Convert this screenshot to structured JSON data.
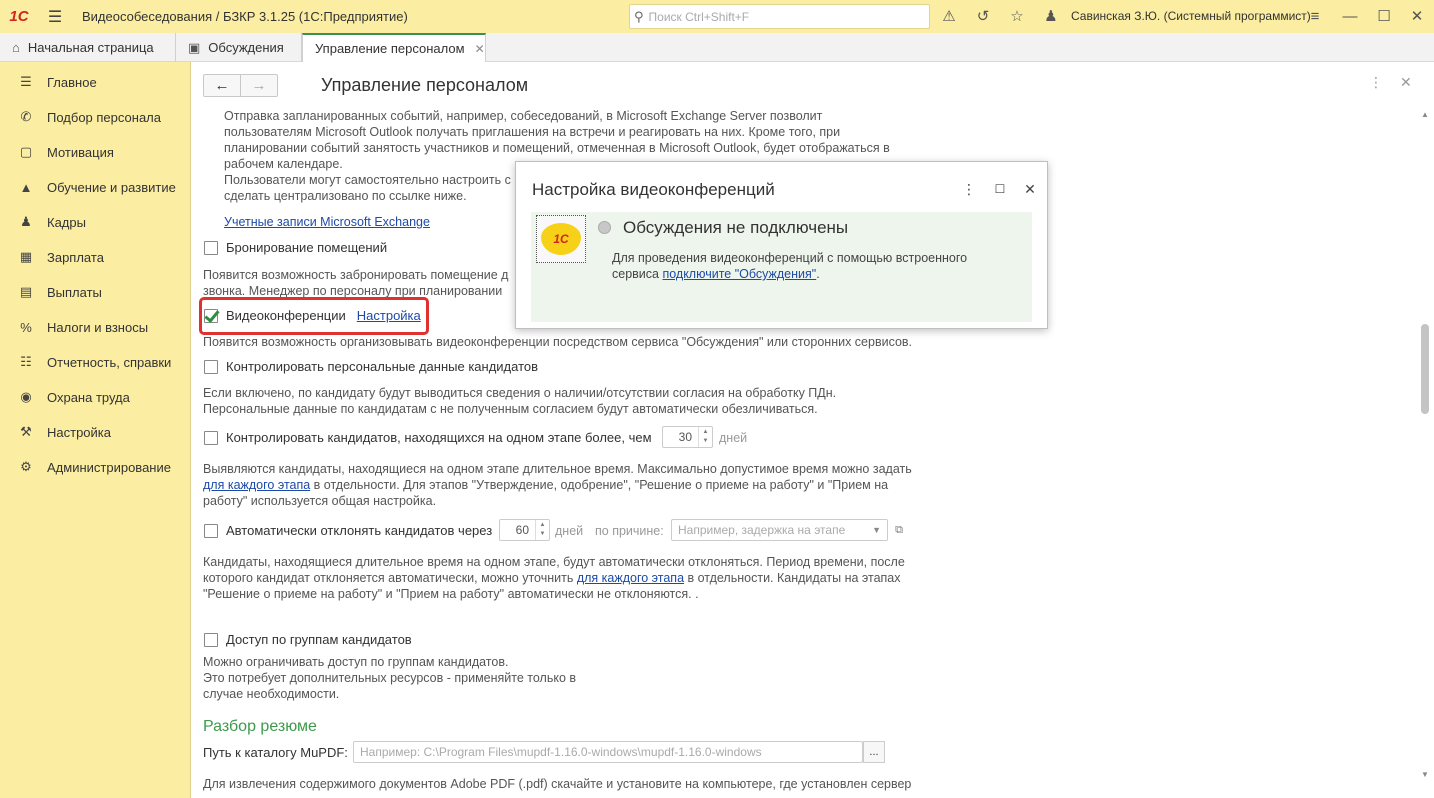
{
  "titlebar": {
    "logo": "1С",
    "app_title": "Видеособеседования / БЗКР 3.1.25  (1С:Предприятие)",
    "search_placeholder": "Поиск Ctrl+Shift+F",
    "user": "Савинская З.Ю. (Системный программист)",
    "icons": [
      "hamburger-icon",
      "bell-icon",
      "history-icon",
      "star-icon",
      "user-icon",
      "settings-lines-icon",
      "minimize-icon",
      "maximize-icon",
      "close-icon"
    ]
  },
  "tabs": [
    {
      "label": "Начальная страница",
      "icon": "home-icon"
    },
    {
      "label": "Обсуждения",
      "icon": "chat-icon"
    },
    {
      "label": "Управление персоналом",
      "icon": "",
      "active": true
    }
  ],
  "sidebar": {
    "items": [
      {
        "label": "Главное",
        "icon": "menu-icon"
      },
      {
        "label": "Подбор персонала",
        "icon": "phone-icon"
      },
      {
        "label": "Мотивация",
        "icon": "gift-icon"
      },
      {
        "label": "Обучение и развитие",
        "icon": "graduation-icon"
      },
      {
        "label": "Кадры",
        "icon": "people-icon"
      },
      {
        "label": "Зарплата",
        "icon": "calculator-icon"
      },
      {
        "label": "Выплаты",
        "icon": "list-icon"
      },
      {
        "label": "Налоги и взносы",
        "icon": "percent-icon"
      },
      {
        "label": "Отчетность, справки",
        "icon": "report-icon"
      },
      {
        "label": "Охрана труда",
        "icon": "helmet-icon"
      },
      {
        "label": "Настройка",
        "icon": "wrench-icon"
      },
      {
        "label": "Администрирование",
        "icon": "gear-icon"
      }
    ]
  },
  "main": {
    "title": "Управление персоналом",
    "exchange_text": [
      "Отправка запланированных событий, например, собеседований, в Microsoft Exchange Server позволит",
      "пользователям Microsoft Outlook получать приглашения на встречи и реагировать на них. Кроме того, при",
      "планировании событий занятость участников и помещений, отмеченная в Microsoft Outlook, будет отображаться в",
      "рабочем календаре.",
      "Пользователи могут самостоятельно настроить с",
      "сделать централизовано по ссылке ниже."
    ],
    "exchange_link": "Учетные записи Microsoft Exchange",
    "booking_label": "Бронирование помещений",
    "booking_text": [
      "Появится возможность забронировать помещение д",
      "звонка. Менеджер по персоналу при планировании"
    ],
    "video_label": "Видеоконференции",
    "video_link": "Настройка",
    "video_text": "Появится возможность организовывать видеоконференции посредством сервиса \"Обсуждения\" или сторонних сервисов.",
    "pd_label": "Контролировать персональные данные кандидатов",
    "pd_text": [
      "Если включено, по кандидату будут выводиться сведения о наличии/отсутствии согласия на обработку ПДн.",
      "Персональные данные по кандидатам с не полученным согласием будут автоматически обезличиваться."
    ],
    "stage_label": "Контролировать кандидатов, находящихся на одном этапе более, чем",
    "stage_days": "30",
    "days_unit": "дней",
    "stage_text_1": "Выявляются кандидаты, находящиеся на одном этапе длительное время. Максимально допустимое время можно задать",
    "stage_link": "для каждого этапа",
    "stage_text_2": " в отдельности. Для этапов \"Утверждение, одобрение\", \"Решение о приеме на работу\" и \"Прием на",
    "stage_text_3": "работу\" используется общая настройка.",
    "reject_label": "Автоматически отклонять кандидатов через",
    "reject_days": "60",
    "reason_label": "по причине:",
    "reason_placeholder": "Например, задержка на этапе",
    "reject_text_1": "Кандидаты, находящиеся длительное время на одном этапе, будут автоматически отклоняться. Период времени, после",
    "reject_text_2a": "которого кандидат отклоняется автоматически, можно уточнить ",
    "reject_link": "для каждого этапа",
    "reject_text_2b": " в отдельности. Кандидаты на этапах",
    "reject_text_3": "\"Решение о приеме на работу\" и \"Прием на работу\" автоматически не отклоняются. .",
    "groups_label": "Доступ по группам кандидатов",
    "groups_text": [
      "Можно ограничивать доступ по группам кандидатов.",
      "Это потребует дополнительных ресурсов - применяйте только в",
      "случае необходимости."
    ],
    "resume_section": "Разбор резюме",
    "mupdf_label": "Путь к каталогу MuPDF:",
    "mupdf_placeholder": "Например: C:\\Program Files\\mupdf-1.16.0-windows\\mupdf-1.16.0-windows",
    "mupdf_btn": "...",
    "bottom_text": "Для извлечения содержимого документов Adobe PDF (.pdf) скачайте и установите на компьютере, где установлен сервер"
  },
  "dialog": {
    "title": "Настройка видеоконференций",
    "heading": "Обсуждения не подключены",
    "text_1": "Для проведения видеоконференций с помощью встроенного",
    "text_2a": "сервиса ",
    "link": "подключите \"Обсуждения\"",
    "text_2b": ".",
    "logo": "1С"
  },
  "colors": {
    "titlebar_bg": "#fbeda1",
    "accent_green": "#3d9a4c",
    "highlight_red": "#e03131",
    "link_blue": "#1d4aa8"
  }
}
